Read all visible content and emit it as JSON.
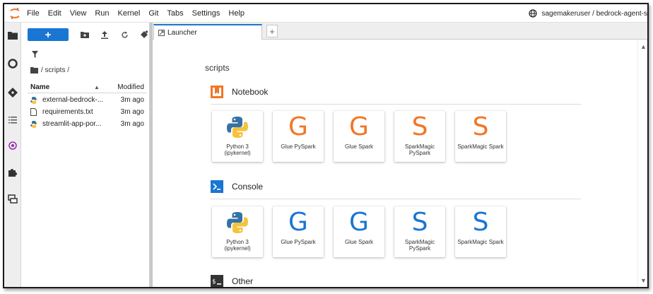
{
  "menubar": {
    "items": [
      "File",
      "Edit",
      "View",
      "Run",
      "Kernel",
      "Git",
      "Tabs",
      "Settings",
      "Help"
    ],
    "user": "sagemakeruser / bedrock-agent-s"
  },
  "filebrowser": {
    "new_label": "+",
    "breadcrumb": "/ scripts /",
    "col_name": "Name",
    "col_modified": "Modified",
    "files": [
      {
        "name": "external-bedrock-...",
        "modified": "3m ago",
        "type": "python"
      },
      {
        "name": "requirements.txt",
        "modified": "3m ago",
        "type": "text"
      },
      {
        "name": "streamlit-app-por...",
        "modified": "3m ago",
        "type": "python"
      }
    ]
  },
  "tabs": {
    "active_label": "Launcher",
    "add_label": "+"
  },
  "launcher": {
    "folder": "scripts",
    "sections": [
      {
        "label": "Notebook",
        "color": "#f37626"
      },
      {
        "label": "Console",
        "color": "#1976d2"
      },
      {
        "label": "Other",
        "color": "#333333"
      }
    ],
    "notebook_cards": [
      {
        "label": "Python 3 (ipykernel)",
        "logo": "python"
      },
      {
        "label": "Glue PySpark",
        "logo": "G"
      },
      {
        "label": "Glue Spark",
        "logo": "G"
      },
      {
        "label": "SparkMagic PySpark",
        "logo": "S"
      },
      {
        "label": "SparkMagic Spark",
        "logo": "S"
      }
    ],
    "console_cards": [
      {
        "label": "Python 3 (ipykernel)",
        "logo": "python"
      },
      {
        "label": "Glue PySpark",
        "logo": "G"
      },
      {
        "label": "Glue Spark",
        "logo": "G"
      },
      {
        "label": "SparkMagic PySpark",
        "logo": "S"
      },
      {
        "label": "SparkMagic Spark",
        "logo": "S"
      }
    ]
  },
  "colors": {
    "accent": "#1976d2",
    "notebook_letters": "#f37626",
    "console_letters": "#1976d2"
  }
}
